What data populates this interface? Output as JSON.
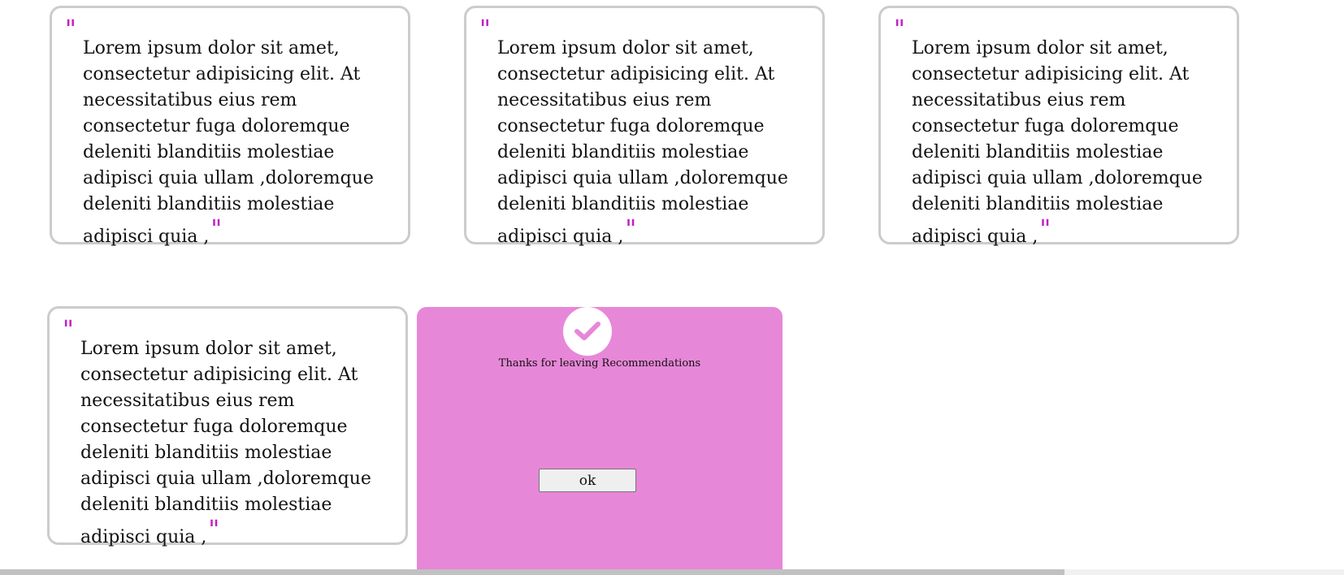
{
  "cards": [
    {
      "text": "Lorem ipsum dolor sit amet, consectetur adipisicing elit. At necessitatibus eius rem consectetur fuga doloremque deleniti blanditiis molestiae adipisci quia ullam ,doloremque deleniti blanditiis molestiae adipisci quia ,"
    },
    {
      "text": "Lorem ipsum dolor sit amet, consectetur adipisicing elit. At necessitatibus eius rem consectetur fuga doloremque deleniti blanditiis molestiae adipisci quia ullam ,doloremque deleniti blanditiis molestiae adipisci quia ,"
    },
    {
      "text": "Lorem ipsum dolor sit amet, consectetur adipisicing elit. At necessitatibus eius rem consectetur fuga doloremque deleniti blanditiis molestiae adipisci quia ullam ,doloremque deleniti blanditiis molestiae adipisci quia ,"
    },
    {
      "text": "Lorem ipsum dolor sit amet, consectetur adipisicing elit. At necessitatibus eius rem consectetur fuga doloremque deleniti blanditiis molestiae adipisci quia ullam ,doloremque deleniti blanditiis molestiae adipisci quia ,"
    }
  ],
  "quote_mark": "\"",
  "dialog": {
    "message": "Thanks for leaving Recommendations",
    "ok_label": "ok",
    "icon": "check-icon"
  },
  "colors": {
    "accent": "#c21fc2",
    "dialog_bg": "#e787d8",
    "card_border": "#cccccc"
  }
}
